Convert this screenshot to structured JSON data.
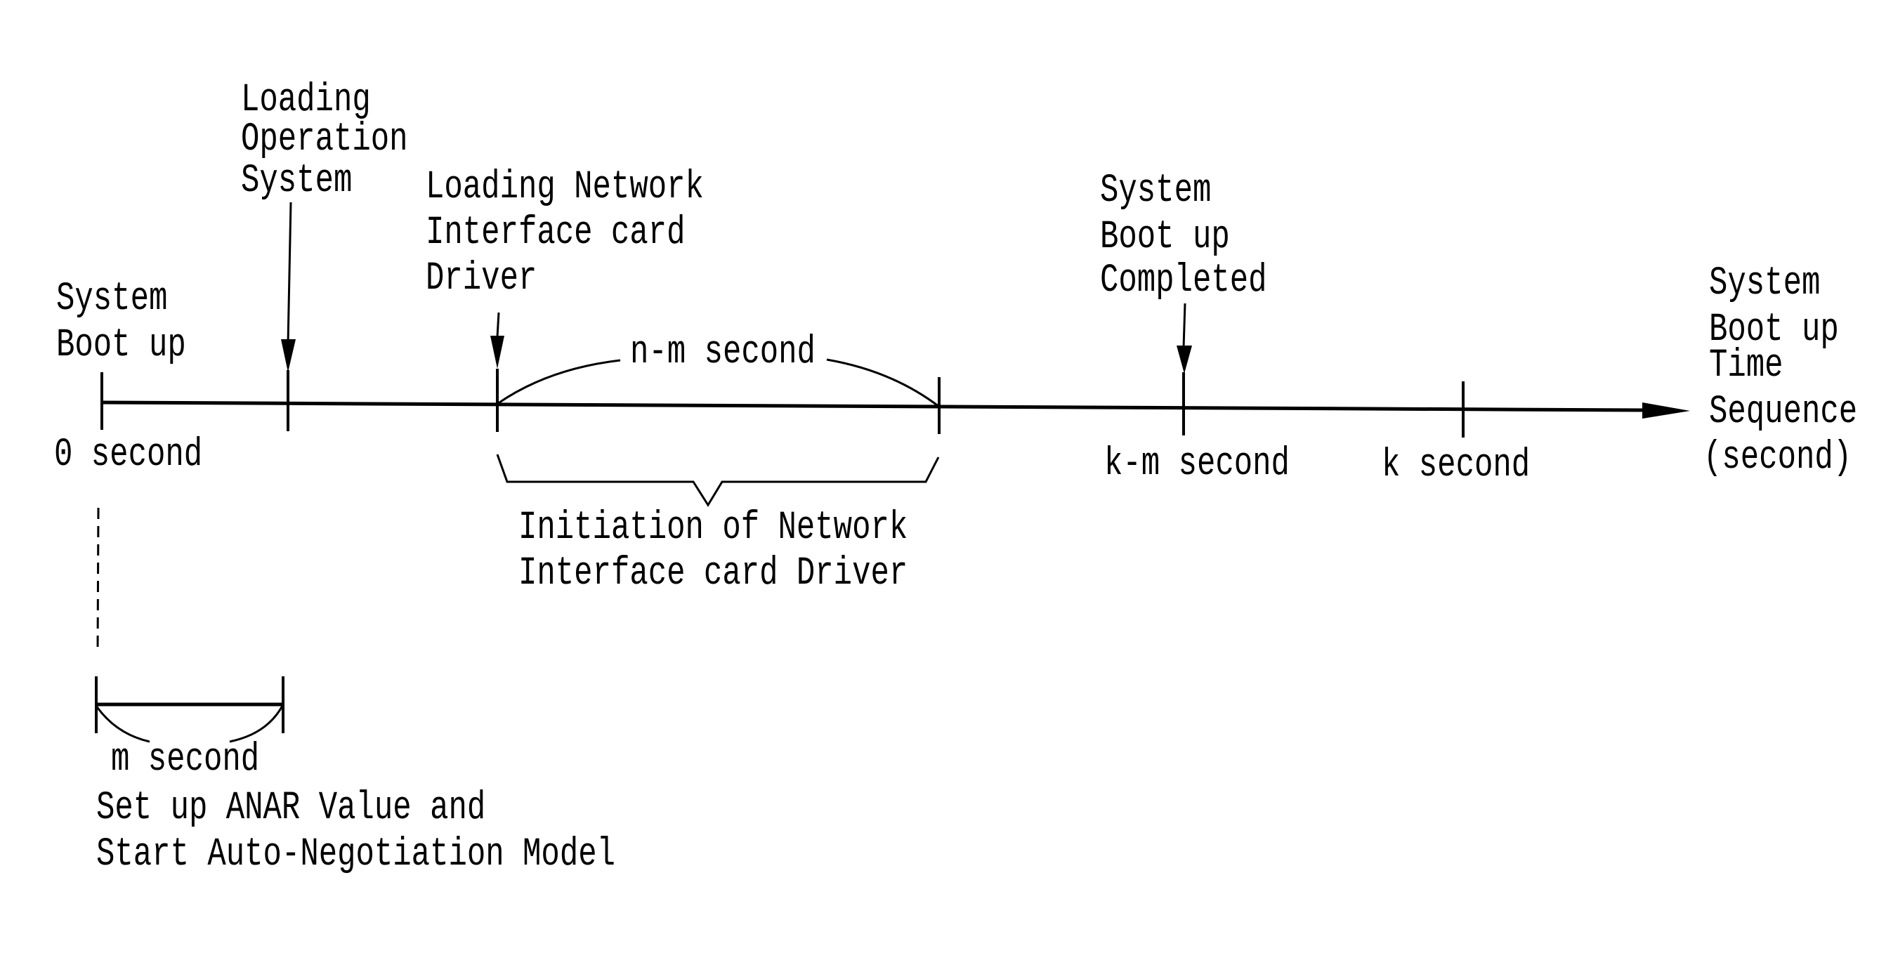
{
  "diagram": {
    "type": "timeline",
    "axis_label": [
      "System",
      "Boot up",
      "Time",
      "Sequence",
      "(second)"
    ],
    "events": {
      "boot": [
        "System",
        "Boot up"
      ],
      "os": [
        "Loading",
        "Operation",
        "System"
      ],
      "nic": [
        "Loading Network",
        "Interface card",
        "Driver"
      ],
      "completed": [
        "System",
        "Boot up",
        "Completed"
      ]
    },
    "ticks": {
      "zero": "0 second",
      "km": "k-m second",
      "k": "k second"
    },
    "spans": {
      "nm": "n-m second",
      "init": [
        "Initiation of Network",
        "Interface card Driver"
      ],
      "m": "m second",
      "anar": [
        "Set up ANAR Value and",
        "Start Auto-Negotiation Model"
      ]
    },
    "colors": {
      "ink": "#000000",
      "background": "#ffffff"
    }
  }
}
